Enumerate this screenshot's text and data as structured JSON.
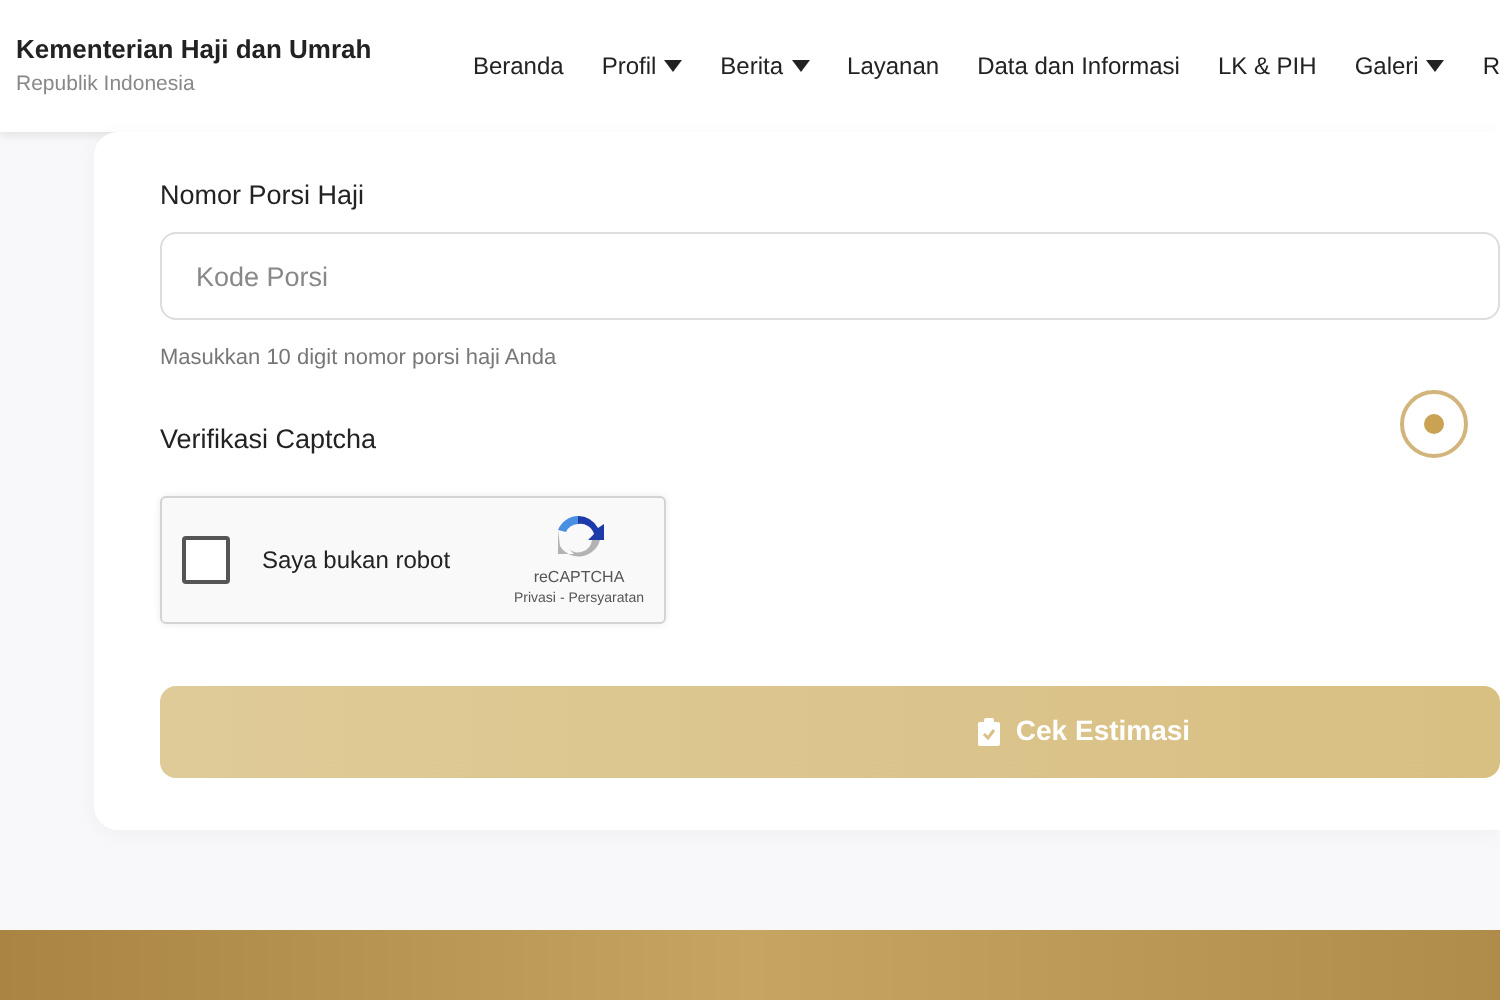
{
  "header": {
    "title": "Kementerian Haji dan Umrah",
    "subtitle": "Republik Indonesia",
    "nav": [
      {
        "label": "Beranda",
        "dropdown": false
      },
      {
        "label": "Profil",
        "dropdown": true
      },
      {
        "label": "Berita",
        "dropdown": true
      },
      {
        "label": "Layanan",
        "dropdown": false
      },
      {
        "label": "Data dan Informasi",
        "dropdown": false
      },
      {
        "label": "LK & PIH",
        "dropdown": false
      },
      {
        "label": "Galeri",
        "dropdown": true
      },
      {
        "label": "R",
        "dropdown": false
      }
    ]
  },
  "form": {
    "porsi_label": "Nomor Porsi Haji",
    "porsi_placeholder": "Kode Porsi",
    "porsi_help": "Masukkan 10 digit nomor porsi haji Anda",
    "captcha_label": "Verifikasi Captcha",
    "captcha": {
      "checked": false,
      "text": "Saya bukan robot",
      "brand": "reCAPTCHA",
      "privacy": "Privasi",
      "separator": "-",
      "terms": "Persyaratan"
    },
    "submit": "Cek Estimasi"
  }
}
